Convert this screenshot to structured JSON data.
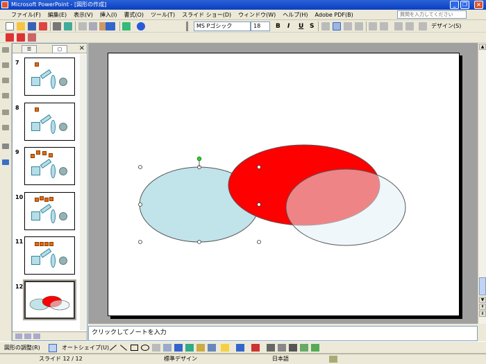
{
  "window": {
    "title": "Microsoft PowerPoint - [図形の作成]",
    "btn_min": "_",
    "btn_max": "❐",
    "btn_close": "×"
  },
  "menu": {
    "items": [
      "ファイル(F)",
      "編集(E)",
      "表示(V)",
      "挿入(I)",
      "書式(O)",
      "ツール(T)",
      "スライド ショー(D)",
      "ウィンドウ(W)",
      "ヘルプ(H)",
      "Adobe PDF(B)"
    ],
    "ask_placeholder": "質問を入力してください"
  },
  "formatting": {
    "font": "MS Pゴシック",
    "size": "18",
    "bold": "B",
    "italic": "I",
    "underline": "U",
    "shadow": "S",
    "design_label": "デザイン(S)"
  },
  "panel": {
    "tab_outline": "☰",
    "tab_slides": "▢",
    "close": "×",
    "slides": [
      {
        "number": "7"
      },
      {
        "number": "8"
      },
      {
        "number": "9"
      },
      {
        "number": "10"
      },
      {
        "number": "11"
      },
      {
        "number": "12"
      }
    ]
  },
  "notes": {
    "placeholder": "クリックしてノートを入力"
  },
  "drawing": {
    "adjust_label": "図形の調整(R)",
    "autoshape_label": "オートシェイプ(U)"
  },
  "status": {
    "slide_info": "スライド 12 / 12",
    "design": "標準デザイン",
    "language": "日本語"
  },
  "colors": {
    "red": "#ff0000",
    "light_blue": "#c1e3ea",
    "translucent_blue": "#e1f1f5",
    "orange": "#e46c0a"
  }
}
